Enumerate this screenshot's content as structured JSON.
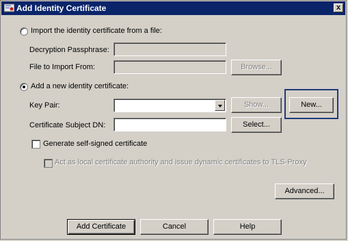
{
  "window": {
    "title": "Add Identity Certificate",
    "close_glyph": "x"
  },
  "import_option": {
    "label": "Import the identity certificate from a file:",
    "selected": false,
    "passphrase_label": "Decryption Passphrase:",
    "passphrase_value": "",
    "file_label": "File to Import From:",
    "file_value": "",
    "browse_label": "Browse..."
  },
  "add_option": {
    "label": "Add a new identity certificate:",
    "selected": true,
    "key_pair_label": "Key Pair:",
    "key_pair_value": "",
    "show_label": "Show...",
    "new_label": "New...",
    "subject_dn_label": "Certificate Subject DN:",
    "subject_dn_value": "",
    "select_label": "Select...",
    "self_signed_label": "Generate self-signed certificate",
    "self_signed_checked": false,
    "local_ca_label": "Act as local certificate authority and issue dynamic certificates to TLS-Proxy",
    "local_ca_checked": false
  },
  "advanced_label": "Advanced...",
  "footer": {
    "add_label": "Add Certificate",
    "cancel_label": "Cancel",
    "help_label": "Help"
  },
  "colors": {
    "titlebar": "#0a246a",
    "face": "#d4d0c8",
    "highlight_box": "#1f3a7a"
  },
  "icons": {
    "app": "certificate-icon",
    "close": "close-icon",
    "dropdown": "chevron-down-icon"
  }
}
